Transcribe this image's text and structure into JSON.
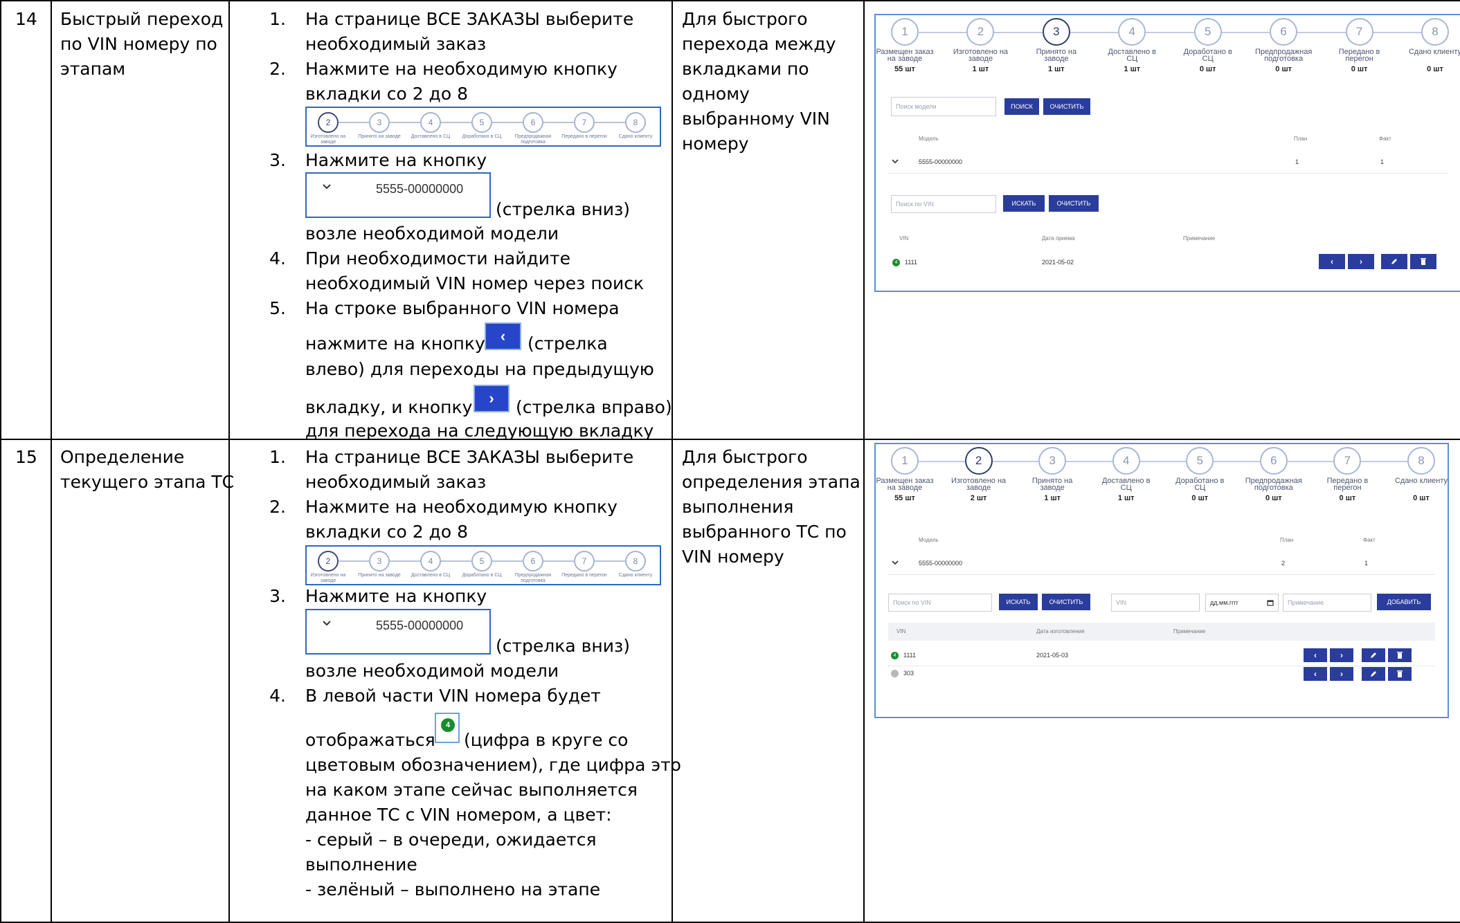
{
  "rows": [
    {
      "number": "14",
      "title": [
        "Быстрый переход",
        "по VIN номеру по",
        "этапам"
      ],
      "steps": {
        "s1": [
          "На странице ВСЕ ЗАКАЗЫ выберите",
          "необходимый заказ"
        ],
        "s2": [
          "Нажмите на необходимую кнопку",
          "вкладки со 2 до 8"
        ],
        "s3_head": "Нажмите на кнопку",
        "s3_after": "(стрелка вниз)",
        "s3_tail": "возле необходимой модели",
        "s4": [
          "При необходимости найдите",
          "необходимый VIN номер через поиск"
        ],
        "s5_l1": "На строке выбранного VIN номера",
        "s5_l2a": "нажмите на кнопку",
        "s5_l2b": "(стрелка",
        "s5_l3": "влево) для переходы на предыдущую",
        "s5_l4a": "вкладку, и кнопку",
        "s5_l4b": "(стрелка вправо)",
        "s5_l5": "для перехода на следующую вкладку"
      },
      "purpose": [
        "Для быстрого",
        "перехода между",
        "вкладками по",
        "одному",
        "выбранному VIN",
        "номеру"
      ]
    },
    {
      "number": "15",
      "title": [
        "Определение",
        "текущего этапа ТС"
      ],
      "steps": {
        "s1": [
          "На странице ВСЕ ЗАКАЗЫ выберите",
          "необходимый заказ"
        ],
        "s2": [
          "Нажмите на необходимую кнопку",
          "вкладки со 2 до 8"
        ],
        "s3_head": "Нажмите на кнопку",
        "s3_after": "(стрелка вниз)",
        "s3_tail": "возле необходимой модели",
        "s4_l1": "В левой части VIN номера будет",
        "s4_l2a": "отображаться",
        "s4_l2b": "(цифра в круге со",
        "s4_rest": [
          "цветовым обозначением), где цифра это",
          "на каком этапе сейчас выполняется",
          "данное ТС с VIN номером, а цвет:",
          "- серый – в очереди, ожидается",
          "выполнение",
          "- зелёный – выполнено на этапе"
        ]
      },
      "purpose": [
        "Для быстрого",
        "определения этапа",
        "выполнения",
        "выбранного ТС по",
        "VIN номеру"
      ]
    }
  ],
  "list_numbers": [
    "1.",
    "2.",
    "3.",
    "4.",
    "5."
  ],
  "mini_stepper": {
    "numbers": [
      "2",
      "3",
      "4",
      "5",
      "6",
      "7",
      "8"
    ],
    "labels": [
      "Изготовлено на заводе",
      "Принято на заводе",
      "Доставлено в СЦ",
      "Доработано в СЦ",
      "Предпродажная подготовка",
      "Передано в перегон",
      "Сдано клиенту"
    ]
  },
  "dropdown": {
    "model": "5555-00000000"
  },
  "arrow_buttons": {
    "left": "‹",
    "right": "›"
  },
  "badge": {
    "value": "4",
    "color": "#1a8c2e"
  },
  "stages": {
    "numbers": [
      "1",
      "2",
      "3",
      "4",
      "5",
      "6",
      "7",
      "8"
    ],
    "labels": [
      [
        "Размещен заказ",
        "на заводе"
      ],
      [
        "Изготовлено на",
        "заводе"
      ],
      [
        "Принято на",
        "заводе"
      ],
      [
        "Доставлено в",
        "СЦ"
      ],
      [
        "Доработано в",
        "СЦ"
      ],
      [
        "Предпродажная",
        "подготовка"
      ],
      [
        "Передано в",
        "перегон"
      ],
      [
        "Сдано клиенту",
        ""
      ]
    ]
  },
  "shot1": {
    "counts": [
      "55 шт",
      "1 шт",
      "1 шт",
      "1 шт",
      "0 шт",
      "0 шт",
      "0 шт",
      "0 шт"
    ],
    "model_search_placeholder": "Поиск модели",
    "search_btn": "ПОИСК",
    "clear_btn": "ОЧИСТИТЬ",
    "model_headers": [
      "Модель",
      "План",
      "Факт"
    ],
    "model_row": {
      "model": "5555-00000000",
      "plan": "1",
      "fact": "1"
    },
    "vin_search_placeholder": "Поиск по VIN",
    "find_btn": "ИСКАТЬ",
    "vin_clear_btn": "ОЧИСТИТЬ",
    "vin_headers": [
      "VIN",
      "Дата приема",
      "Примечание"
    ],
    "vin_row": {
      "badge": "4",
      "vin": "1111",
      "date": "2021-05-02"
    }
  },
  "shot2": {
    "counts": [
      "55 шт",
      "2 шт",
      "1 шт",
      "1 шт",
      "0 шт",
      "0 шт",
      "0 шт",
      "0 шт"
    ],
    "model_headers": [
      "Модель",
      "План",
      "Факт"
    ],
    "model_row": {
      "model": "5555-00000000",
      "plan": "2",
      "fact": "1"
    },
    "vin_search_placeholder": "Поиск по VIN",
    "find_btn": "ИСКАТЬ",
    "vin_clear_btn": "ОЧИСТИТЬ",
    "vin_input_placeholder": "VIN",
    "date_placeholder": "дд.мм.гггг",
    "note_placeholder": "Примечание",
    "add_btn": "ДОБАВИТЬ",
    "vin_headers": [
      "VIN",
      "Дата изготовления",
      "Примечание"
    ],
    "vin_rows": [
      {
        "badge": "4",
        "vin": "1111",
        "date": "2021-05-03",
        "color": "#1a8c2e"
      },
      {
        "badge": "",
        "vin": "303",
        "date": "",
        "color": "#b8b8b8"
      }
    ]
  },
  "icons": {
    "chevron": "chevron-down-icon",
    "edit": "pencil-icon",
    "delete": "trash-icon",
    "calendar": "calendar-icon"
  }
}
